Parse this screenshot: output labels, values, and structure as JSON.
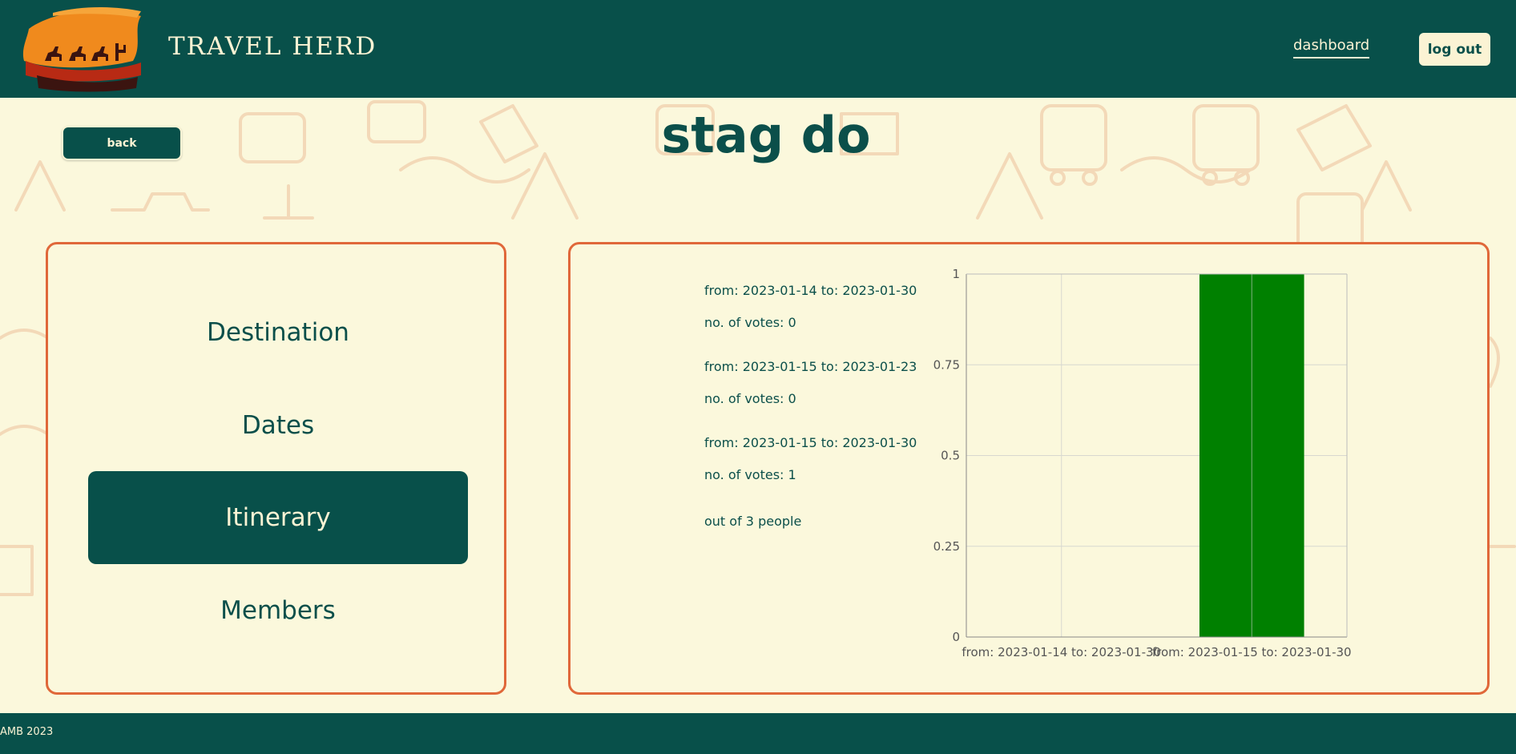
{
  "header": {
    "brand": "TRAVEL HERD",
    "nav_dashboard": "dashboard",
    "logout_label": "log out"
  },
  "page": {
    "back_label": "back",
    "title": "stag do"
  },
  "menu": {
    "items": [
      {
        "label": "Destination"
      },
      {
        "label": "Dates"
      },
      {
        "label": "Itinerary"
      },
      {
        "label": "Members"
      }
    ],
    "active": "Itinerary"
  },
  "votes": {
    "options": [
      {
        "range": "from: 2023-01-14 to: 2023-01-30",
        "votes_text": "no. of votes: 0"
      },
      {
        "range": "from: 2023-01-15 to: 2023-01-23",
        "votes_text": "no. of votes: 0"
      },
      {
        "range": "from: 2023-01-15 to: 2023-01-30",
        "votes_text": "no. of votes: 1"
      }
    ],
    "total_text": "out of 3 people"
  },
  "chart_data": {
    "type": "bar",
    "categories": [
      "from: 2023-01-14 to: 2023-01-30",
      "from: 2023-01-15 to: 2023-01-30"
    ],
    "values": [
      0,
      1
    ],
    "ylim": [
      0,
      1
    ],
    "yticks": [
      0,
      0.25,
      0.5,
      0.75,
      1
    ],
    "ytick_labels": [
      "0",
      "0.25",
      "0.5",
      "0.75",
      "1"
    ],
    "bar_color": "#008000",
    "grid": true
  },
  "footer": {
    "text": "AMB 2023"
  },
  "colors": {
    "primary": "#08504a",
    "background": "#fbf8dc",
    "accent_border": "#e0683a",
    "cream": "#fbf3d4"
  }
}
